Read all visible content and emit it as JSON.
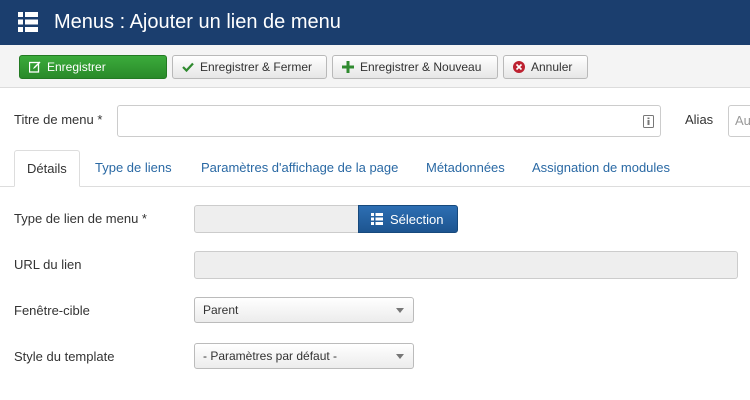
{
  "header": {
    "title": "Menus : Ajouter un lien de menu",
    "icon": "menu-list-icon"
  },
  "toolbar": {
    "save_label": "Enregistrer",
    "save_close_label": "Enregistrer & Fermer",
    "save_new_label": "Enregistrer & Nouveau",
    "cancel_label": "Annuler"
  },
  "form": {
    "title_label": "Titre de menu *",
    "title_value": "",
    "alias_label": "Alias",
    "alias_placeholder": "Au"
  },
  "tabs": [
    {
      "label": "Détails",
      "active": true
    },
    {
      "label": "Type de liens",
      "active": false
    },
    {
      "label": "Paramètres d'affichage de la page",
      "active": false
    },
    {
      "label": "Métadonnées",
      "active": false
    },
    {
      "label": "Assignation de modules",
      "active": false
    }
  ],
  "details": {
    "menu_type_label": "Type de lien de menu *",
    "menu_type_value": "",
    "selection_label": "Sélection",
    "url_label": "URL du lien",
    "url_value": "",
    "target_label": "Fenêtre-cible",
    "target_value": "Parent",
    "template_label": "Style du template",
    "template_value": "- Paramètres par défaut -"
  },
  "colors": {
    "header_bg": "#1b3e6e",
    "save_green": "#2f9b2f",
    "selection_blue": "#2461a4",
    "link_blue": "#2a69a4"
  }
}
